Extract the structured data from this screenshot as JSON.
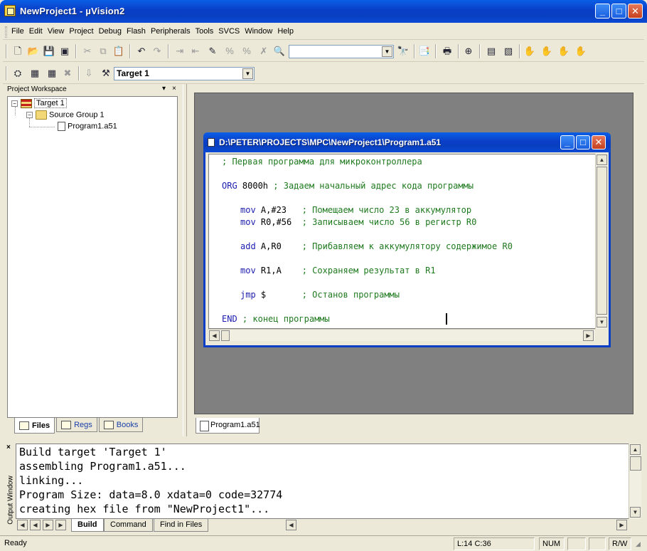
{
  "window": {
    "title": "NewProject1  - µVision2",
    "min_glyph": "_",
    "max_glyph": "□",
    "close_glyph": "✕"
  },
  "menu": [
    "File",
    "Edit",
    "View",
    "Project",
    "Debug",
    "Flash",
    "Peripherals",
    "Tools",
    "SVCS",
    "Window",
    "Help"
  ],
  "toolbar": {
    "find_value": "",
    "target_select": "Target 1"
  },
  "workspace": {
    "title": "Project Workspace",
    "pin_glyph": "▾",
    "close_glyph": "×",
    "tree": {
      "target": "Target 1",
      "group": "Source Group 1",
      "file": "Program1.a51"
    },
    "tabs": [
      "Files",
      "Regs",
      "Books"
    ]
  },
  "editor": {
    "title": "D:\\PETER\\PROJECTS\\MPC\\NewProject1\\Program1.a51",
    "tab": "Program1.a51",
    "lines": [
      {
        "kw": "",
        "tx": "",
        "cm": "; Первая программа для микроконтроллера"
      },
      {
        "kw": "ORG",
        "tx": " 8000h ",
        "cm": "; Задаем начальный адрес кода программы"
      },
      {
        "kw": "mov",
        "tx": " A,#23   ",
        "cm": "; Помещаем число 23 в аккумулятор"
      },
      {
        "kw": "mov",
        "tx": " R0,#56  ",
        "cm": "; Записываем число 56 в регистр R0"
      },
      {
        "kw": "add",
        "tx": " A,R0    ",
        "cm": "; Прибавляем к аккумулятору содержимое R0"
      },
      {
        "kw": "mov",
        "tx": " R1,A    ",
        "cm": "; Сохраняем результат в R1"
      },
      {
        "kw": "jmp",
        "tx": " $       ",
        "cm": "; Останов программы"
      },
      {
        "kw": "END",
        "tx": " ",
        "cm": "; конец программы"
      }
    ]
  },
  "output": {
    "label": "Output Window",
    "close_glyph": "×",
    "lines": [
      "Build target 'Target 1'",
      "assembling Program1.a51...",
      "linking...",
      "Program Size: data=8.0 xdata=0 code=32774",
      "creating hex file from \"NewProject1\"..."
    ],
    "tabs": [
      "Build",
      "Command",
      "Find in Files"
    ]
  },
  "status": {
    "text": "Ready",
    "position": "L:14 C:36",
    "num": "NUM",
    "rw": "R/W"
  }
}
